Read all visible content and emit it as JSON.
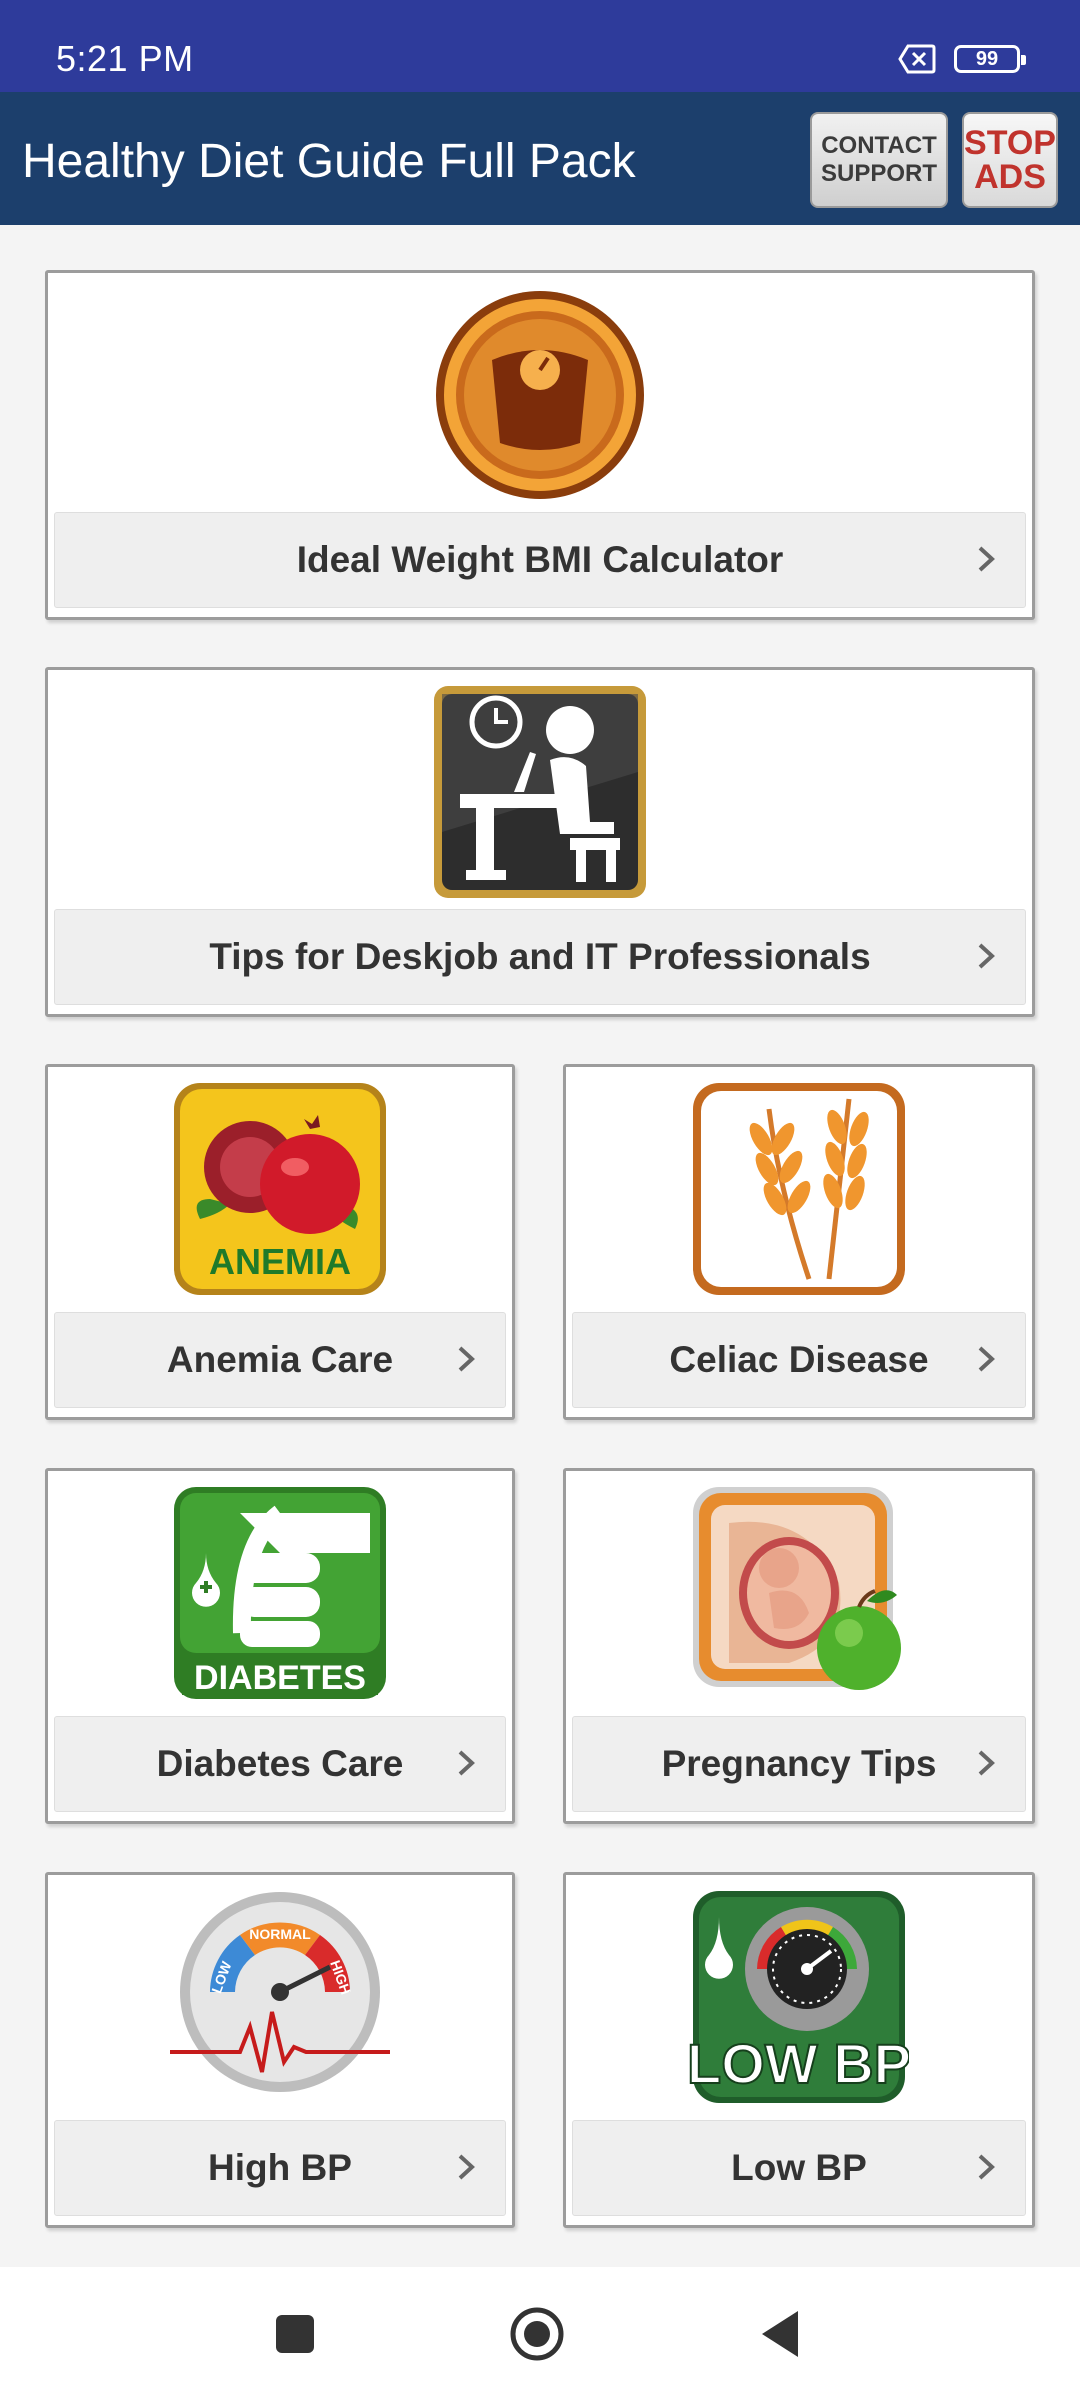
{
  "status_bar": {
    "time": "5:21 PM",
    "battery": "99"
  },
  "app_bar": {
    "title": "Healthy Diet Guide Full Pack",
    "contact_line1": "CONTACT",
    "contact_line2": "SUPPORT",
    "stop_line1": "STOP",
    "stop_line2": "ADS"
  },
  "cards": [
    {
      "label": "Ideal Weight BMI Calculator",
      "icon": "weight-scale-icon"
    },
    {
      "label": "Tips for Deskjob and IT Professionals",
      "icon": "desk-worker-icon"
    },
    {
      "label": "Anemia Care",
      "icon": "anemia-pomegranate-icon",
      "badge": "ANEMIA"
    },
    {
      "label": "Celiac Disease",
      "icon": "wheat-icon"
    },
    {
      "label": "Diabetes Care",
      "icon": "diabetes-hand-icon",
      "badge": "DIABETES"
    },
    {
      "label": "Pregnancy Tips",
      "icon": "pregnancy-icon"
    },
    {
      "label": "High BP",
      "icon": "high-bp-gauge-icon",
      "gauge": [
        "LOW",
        "NORMAL",
        "HIGH"
      ]
    },
    {
      "label": "Low BP",
      "icon": "low-bp-gauge-icon",
      "badge": "LOW BP"
    }
  ],
  "colors": {
    "status_bar": "#2e3b9b",
    "app_bar": "#1c3f6c",
    "card_border": "#9c9c9c"
  }
}
